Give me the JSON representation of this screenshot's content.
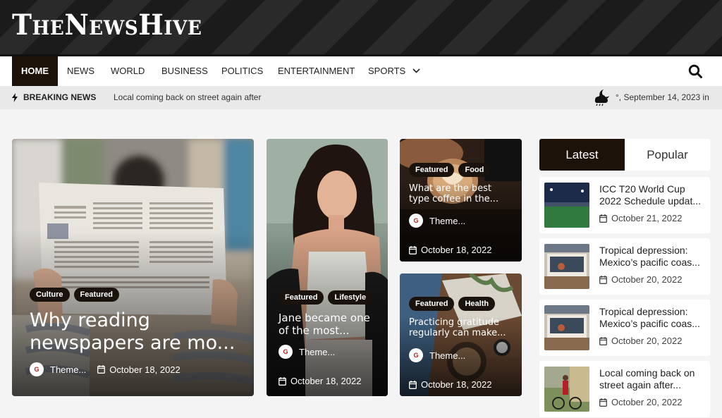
{
  "site": {
    "logo": "TheNewsHive"
  },
  "nav": {
    "items": [
      "HOME",
      "NEWS",
      "WORLD",
      "BUSINESS",
      "POLITICS",
      "ENTERTAINMENT",
      "SPORTS"
    ],
    "search_icon": "search-icon"
  },
  "ticker": {
    "label": "BREAKING NEWS",
    "headline": "Local coming back on street again after",
    "date": "°, September 14, 2023 in"
  },
  "cards": [
    {
      "tags": [
        "Culture",
        "Featured"
      ],
      "title_line1": "Why reading",
      "title_line2": "newspapers are mo...",
      "author": "Theme...",
      "date": "October 18, 2022"
    },
    {
      "tags": [
        "Featured",
        "Lifestyle"
      ],
      "title_line1": "Jane became one",
      "title_line2": "of the most...",
      "author": "Theme...",
      "date": "October 18, 2022"
    },
    {
      "tags": [
        "Featured",
        "Food"
      ],
      "title_line1": "What are the best",
      "title_line2": "type coffee in the...",
      "author": "Theme...",
      "date": "October 18, 2022"
    },
    {
      "tags": [
        "Featured",
        "Health"
      ],
      "title_line1": "Practicing gratitude",
      "title_line2": "regularly can make...",
      "author": "Theme...",
      "date": "October 18, 2022"
    }
  ],
  "sidebar": {
    "tabs": [
      "Latest",
      "Popular"
    ],
    "items": [
      {
        "title_line1": "ICC T20 World Cup",
        "title_line2": "2022 Schedule updat...",
        "date": "October 21, 2022"
      },
      {
        "title_line1": "Tropical depression:",
        "title_line2": "Mexico’s pacific coas...",
        "date": "October 20, 2022"
      },
      {
        "title_line1": "Tropical depression:",
        "title_line2": "Mexico’s pacific coas...",
        "date": "October 20, 2022"
      },
      {
        "title_line1": "Local coming back on",
        "title_line2": "street again after...",
        "date": "October 20, 2022"
      }
    ]
  }
}
